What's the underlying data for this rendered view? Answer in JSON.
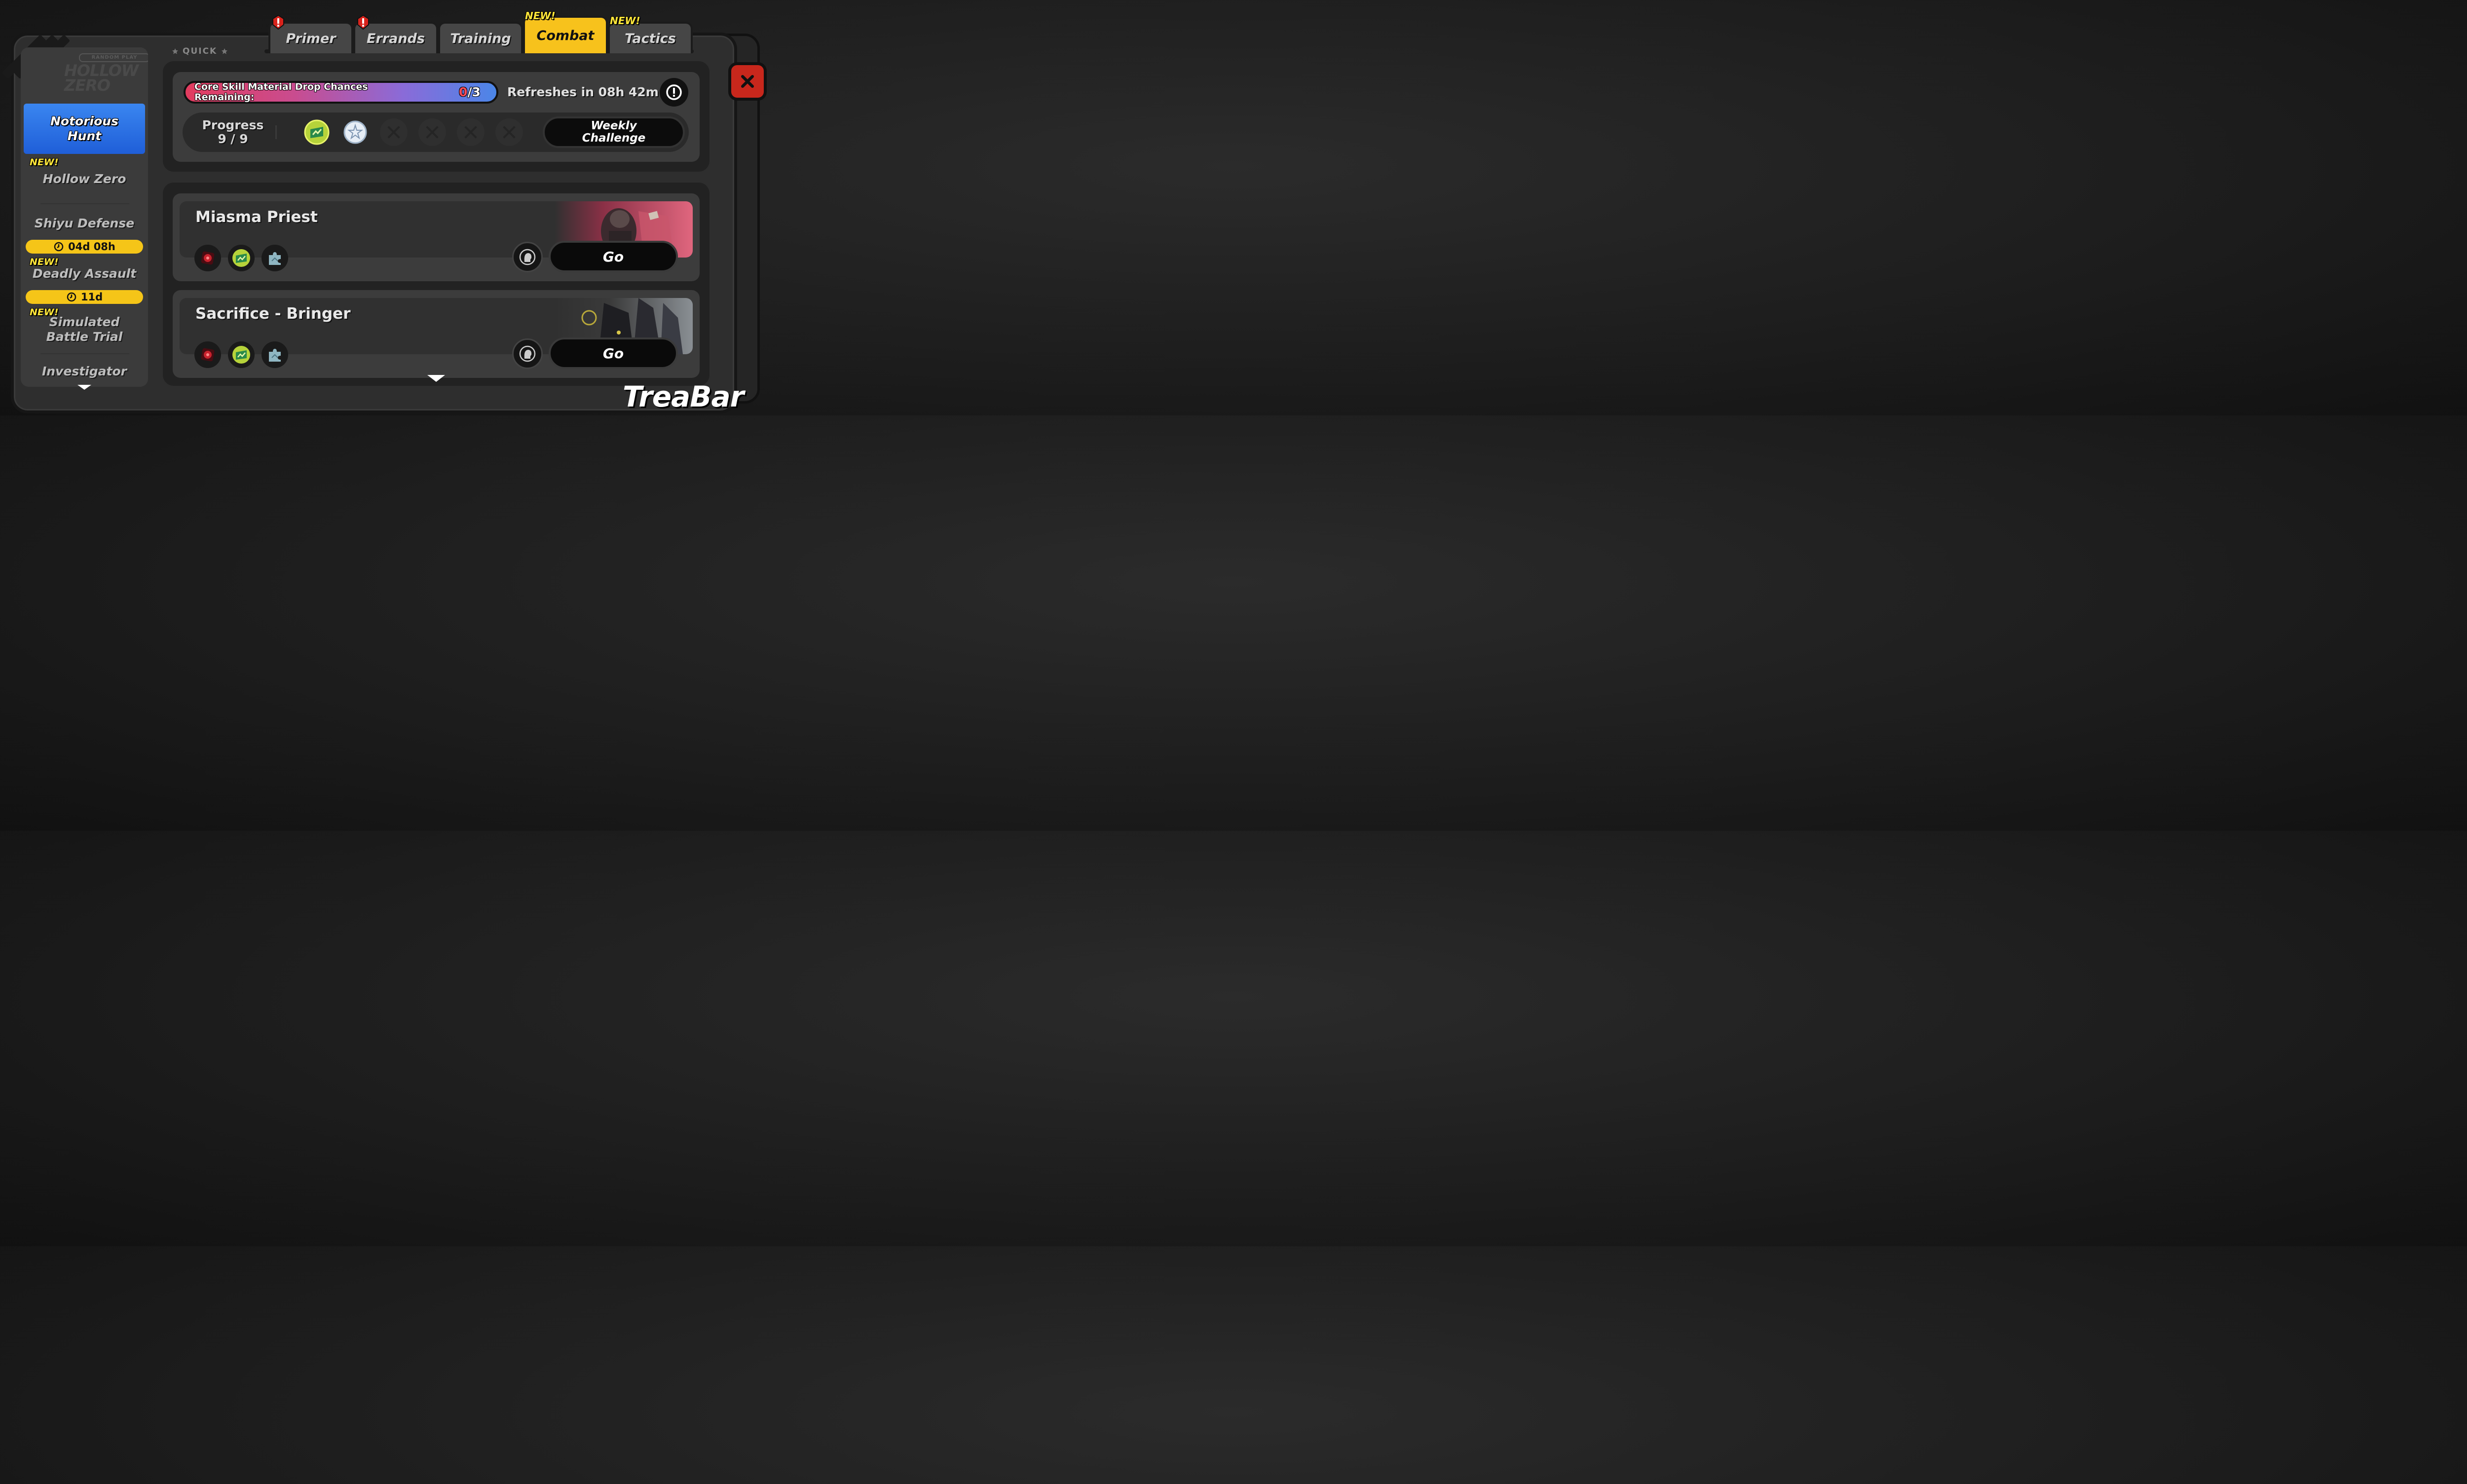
{
  "tabs": [
    {
      "label": "Primer",
      "alert": true,
      "new": false
    },
    {
      "label": "Errands",
      "alert": true,
      "new": false
    },
    {
      "label": "Training",
      "alert": false,
      "new": false
    },
    {
      "label": "Combat",
      "alert": false,
      "new": true,
      "active": true
    },
    {
      "label": "Tactics",
      "alert": false,
      "new": true
    }
  ],
  "new_badge": "NEW!",
  "quick_label": "QUICK",
  "sidebar": {
    "header_tag": "RANDOM PLAY",
    "header_logo": "HOLLOW ZERO",
    "active_item": "Notorious Hunt",
    "items": [
      {
        "label": "Hollow Zero",
        "new": true
      },
      {
        "label": "Shiyu Defense",
        "timer": "04d 08h"
      },
      {
        "label": "Deadly Assault",
        "new": true,
        "timer": "11d"
      },
      {
        "label": "Simulated Battle Trial",
        "new": true
      },
      {
        "label": "Investigator"
      }
    ]
  },
  "drop_chances": {
    "label": "Core Skill Material Drop Chances Remaining:",
    "current": "0",
    "separator": "/",
    "max": "3"
  },
  "refresh": {
    "label": "Refreshes in",
    "time": "08h 42m"
  },
  "progress": {
    "label": "Progress",
    "value": "9 / 9"
  },
  "weekly_challenge": "Weekly Challenge",
  "bosses": [
    {
      "name": "Miasma Priest",
      "go_label": "Go",
      "drop_icons": [
        "red-core-icon",
        "green-chip-icon",
        "puzzle-piece-icon"
      ]
    },
    {
      "name": "Sacrifice - Bringer",
      "go_label": "Go",
      "drop_icons": [
        "red-core-icon",
        "green-chip-icon",
        "puzzle-piece-icon"
      ]
    }
  ],
  "watermark": "TreaBar",
  "colors": {
    "accent": "#f7c21c",
    "active_side": "#2f72e6",
    "close": "#c8271c",
    "new": "#ffe63a"
  }
}
